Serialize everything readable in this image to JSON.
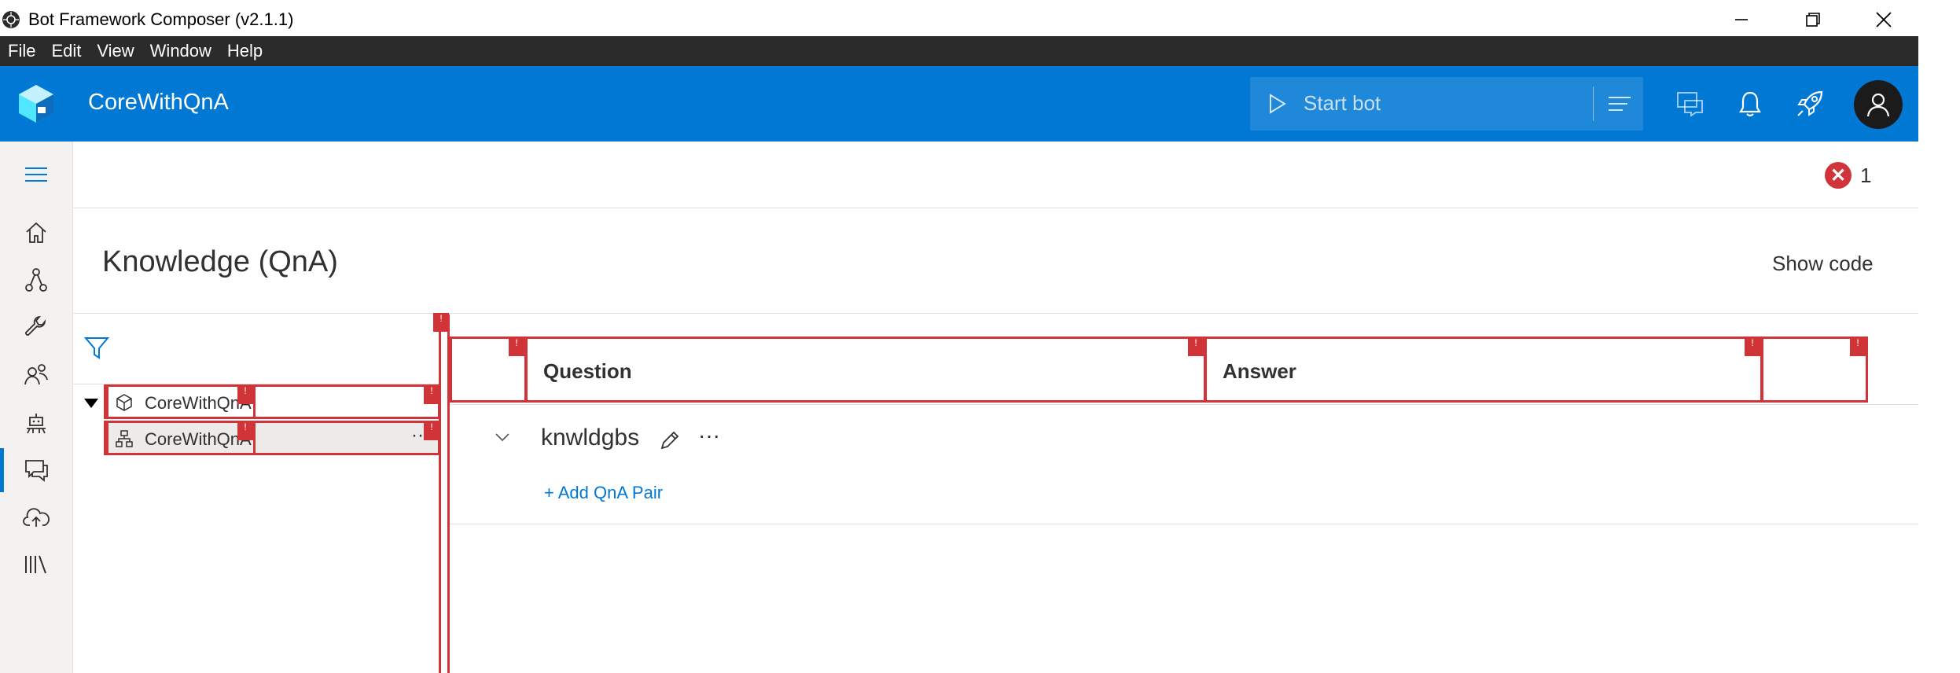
{
  "window": {
    "title": "Bot Framework Composer (v2.1.1)",
    "icon": "composer-app-icon",
    "controls": [
      "minimize-icon",
      "restore-icon",
      "close-icon"
    ]
  },
  "menubar": {
    "items": [
      "File",
      "Edit",
      "View",
      "Window",
      "Help"
    ]
  },
  "header": {
    "bot_name": "CoreWithQnA",
    "start_bot_label": "Start bot",
    "icons": [
      "webchat-icon",
      "notifications-icon",
      "publish-rocket-icon",
      "user-avatar-icon"
    ]
  },
  "nav": {
    "items": [
      {
        "name": "home",
        "icon": "home-icon"
      },
      {
        "name": "design",
        "icon": "design-flow-icon"
      },
      {
        "name": "configure",
        "icon": "wrench-icon"
      },
      {
        "name": "users",
        "icon": "users-icon"
      },
      {
        "name": "bot-responses",
        "icon": "bot-icon"
      },
      {
        "name": "knowledge",
        "icon": "qna-chat-icon",
        "active": true
      },
      {
        "name": "publish",
        "icon": "cloud-upload-icon"
      },
      {
        "name": "library",
        "icon": "library-icon"
      }
    ]
  },
  "errors": {
    "count": "1",
    "icon_glyph": "✕"
  },
  "page": {
    "title": "Knowledge (QnA)",
    "show_code_label": "Show code"
  },
  "tree": {
    "items": [
      {
        "label": "CoreWithQnA",
        "icon": "bot-cube-icon"
      },
      {
        "label": "CoreWithQnA",
        "icon": "dialog-tree-icon",
        "more": "···"
      }
    ],
    "error_glyph": "!"
  },
  "table": {
    "columns": [
      "",
      "Question",
      "Answer",
      ""
    ],
    "group": {
      "name": "knwldgbs",
      "more": "···",
      "add_label": "+ Add QnA Pair"
    }
  },
  "colors": {
    "accent": "#0078d4",
    "error": "#d13438",
    "menubar_bg": "#2b2b2b",
    "nav_bg": "#f3f2f1"
  }
}
